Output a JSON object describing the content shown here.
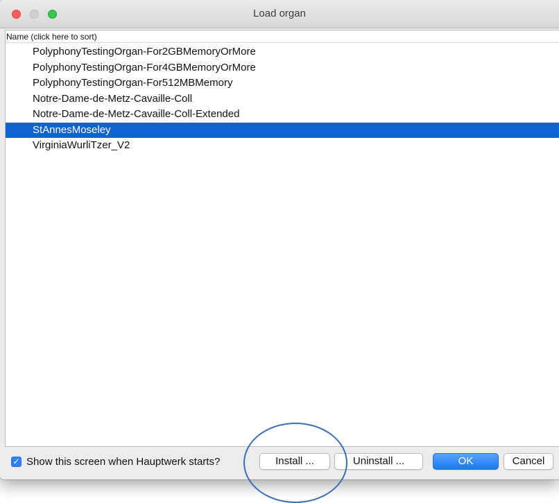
{
  "window": {
    "title": "Load organ"
  },
  "list": {
    "column_header": "Name (click here to sort)",
    "items": [
      {
        "label": "PolyphonyTestingOrgan-For2GBMemoryOrMore",
        "selected": false
      },
      {
        "label": "PolyphonyTestingOrgan-For4GBMemoryOrMore",
        "selected": false
      },
      {
        "label": "PolyphonyTestingOrgan-For512MBMemory",
        "selected": false
      },
      {
        "label": "Notre-Dame-de-Metz-Cavaille-Coll",
        "selected": false
      },
      {
        "label": "Notre-Dame-de-Metz-Cavaille-Coll-Extended",
        "selected": false
      },
      {
        "label": "StAnnesMoseley",
        "selected": true
      },
      {
        "label": "VirginiaWurliTzer_V2",
        "selected": false
      }
    ]
  },
  "footer": {
    "show_on_start_label": "Show this screen when Hauptwerk starts?",
    "show_on_start_checked": true,
    "check_mark": "✓",
    "install_label": "Install ...",
    "uninstall_label": "Uninstall ...",
    "ok_label": "OK",
    "cancel_label": "Cancel"
  },
  "colors": {
    "selection": "#0f62d0",
    "accent": "#1b79f5",
    "annotation_circle": "#3b6fb4"
  }
}
